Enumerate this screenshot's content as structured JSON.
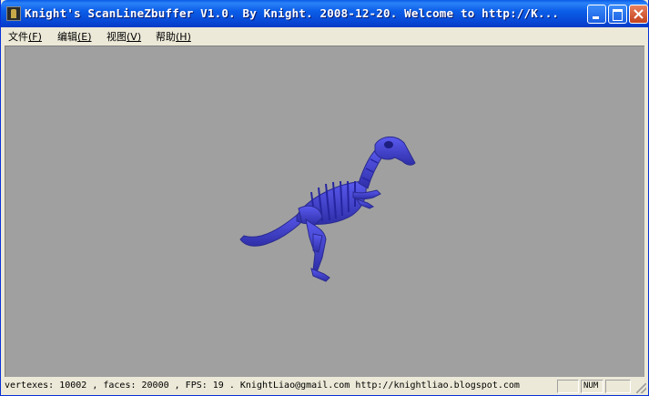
{
  "window": {
    "title": "Knight's ScanLineZbuffer V1.0. By Knight. 2008-12-20.  Welcome to http://K...",
    "icon": "app-icon",
    "controls": [
      "minimize-icon",
      "maximize-icon",
      "close-icon"
    ]
  },
  "menu": {
    "items": [
      {
        "label": "文件",
        "key": "(F)"
      },
      {
        "label": "编辑",
        "key": "(E)"
      },
      {
        "label": "视图",
        "key": "(V)"
      },
      {
        "label": "帮助",
        "key": "(H)"
      }
    ]
  },
  "viewport": {
    "background": "#a0a0a0",
    "model_color": "#4444cc",
    "model": "dinosaur skeleton"
  },
  "status": {
    "text": "vertexes: 10002 , faces: 20000 , FPS: 19 .  KnightLiao@gmail.com  http://knightliao.blogspot.com",
    "num_indicator": "NUM"
  }
}
